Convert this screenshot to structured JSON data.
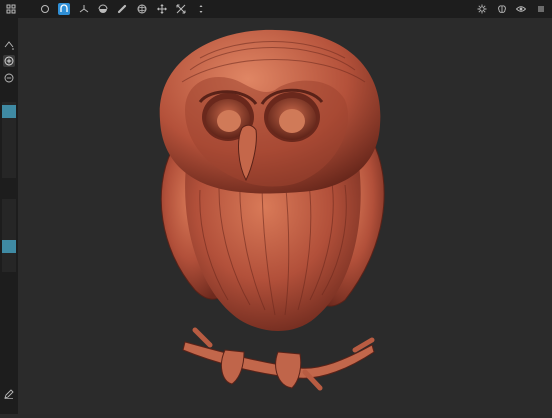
{
  "toolbar": {
    "left_icons": [
      "gallery-icon",
      "scene-icon",
      "brush-icon",
      "curve-icon",
      "mask-icon",
      "measure-icon",
      "sphere-icon",
      "move-icon",
      "transform-icon",
      "more-icon"
    ],
    "active_tool": "brush-icon",
    "right_icons": [
      "sun-icon",
      "brain-icon",
      "eye-icon",
      "settings-icon"
    ]
  },
  "leftbar": {
    "size_slider": 0.12,
    "intensity_slider": 0.62
  },
  "colors": {
    "accent": "#2f8fd6",
    "slider_thumb": "#3f8aa3",
    "model": "#b85a3c"
  }
}
